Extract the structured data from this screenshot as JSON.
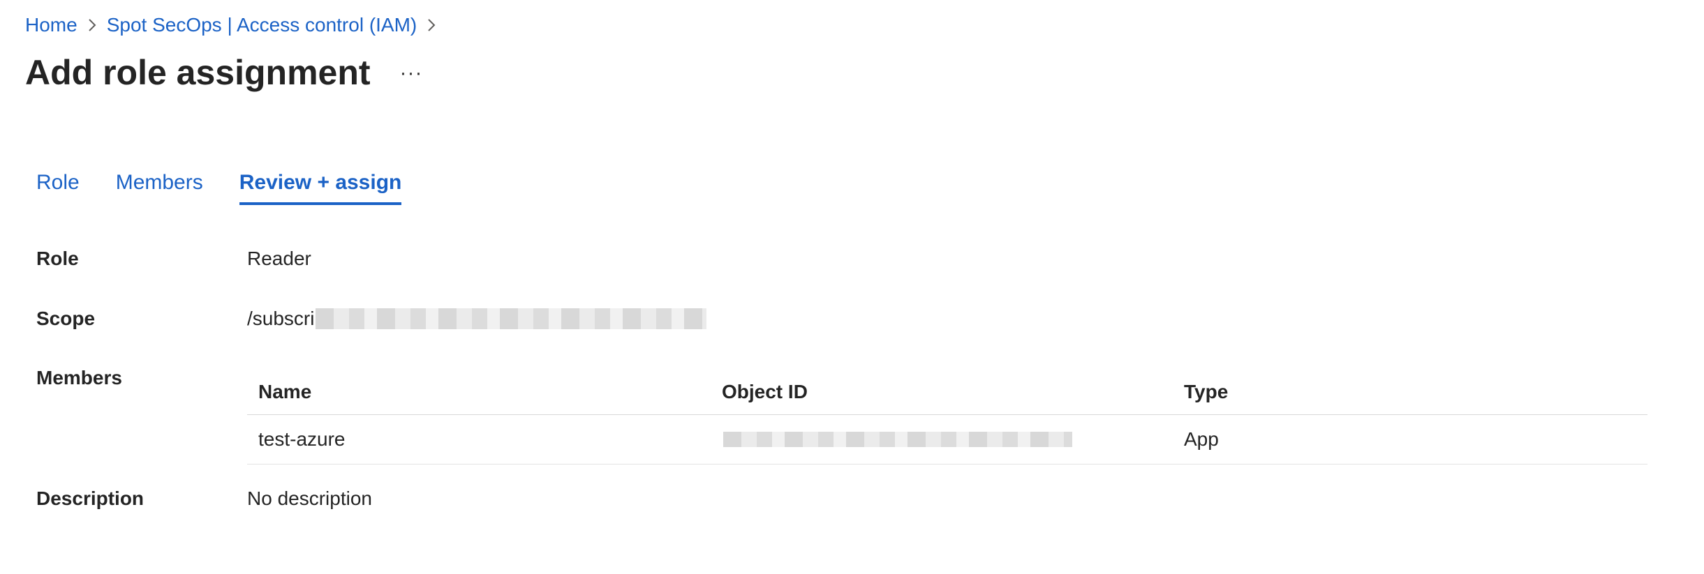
{
  "breadcrumb": {
    "items": [
      {
        "label": "Home"
      },
      {
        "label": "Spot SecOps | Access control (IAM)"
      }
    ]
  },
  "header": {
    "title": "Add role assignment",
    "more_label": "···"
  },
  "tabs": [
    {
      "label": "Role",
      "active": false
    },
    {
      "label": "Members",
      "active": false
    },
    {
      "label": "Review + assign",
      "active": true
    }
  ],
  "review": {
    "role_label": "Role",
    "role_value": "Reader",
    "scope_label": "Scope",
    "scope_value": "/subscri",
    "members_label": "Members",
    "description_label": "Description",
    "description_value": "No description"
  },
  "members_table": {
    "columns": [
      "Name",
      "Object ID",
      "Type"
    ],
    "rows": [
      {
        "name": "test-azure",
        "object_id": "",
        "type": "App"
      }
    ]
  },
  "colors": {
    "link": "#1b62c6",
    "text": "#242424",
    "divider": "#d8d8d8"
  }
}
